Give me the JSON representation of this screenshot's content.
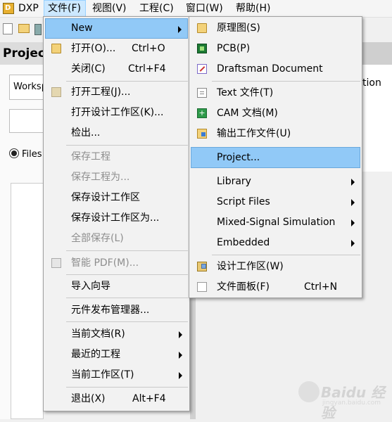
{
  "menubar": {
    "app": "DXP",
    "items": [
      "文件(F)",
      "视图(V)",
      "工程(C)",
      "窗口(W)",
      "帮助(H)"
    ]
  },
  "background": {
    "projects_title": "Projects",
    "workspace_combo": "Workspace",
    "files_radio": "Files",
    "right_partial_text": "tion"
  },
  "file_menu": {
    "new": "New",
    "open": "打开(O)...",
    "open_shortcut": "Ctrl+O",
    "close": "关闭(C)",
    "close_shortcut": "Ctrl+F4",
    "open_project": "打开工程(J)...",
    "open_workspace": "打开设计工作区(K)...",
    "checkout": "检出...",
    "save_project": "保存工程",
    "save_project_as": "保存工程为...",
    "save_workspace": "保存设计工作区",
    "save_workspace_as": "保存设计工作区为...",
    "save_all": "全部保存(L)",
    "smart_pdf": "智能 PDF(M)...",
    "import_wizard": "导入向导",
    "component_release": "元件发布管理器...",
    "current_document": "当前文档(R)",
    "recent_projects": "最近的工程",
    "current_workspace": "当前工作区(T)",
    "exit": "退出(X)",
    "exit_shortcut": "Alt+F4"
  },
  "new_submenu": {
    "schematic": "原理图(S)",
    "pcb": "PCB(P)",
    "draftsman": "Draftsman Document",
    "text_file": "Text  文件(T)",
    "cam_doc": "CAM 文档(M)",
    "output_job": "输出工作文件(U)",
    "project": "Project...",
    "library": "Library",
    "script_files": "Script Files",
    "mixed_signal": "Mixed-Signal Simulation",
    "embedded": "Embedded",
    "design_workspace": "设计工作区(W)",
    "file_panel": "文件面板(F)",
    "file_panel_shortcut": "Ctrl+N"
  },
  "watermark": {
    "text": "Baidu 经验",
    "url": "jingyan.baidu.com"
  }
}
